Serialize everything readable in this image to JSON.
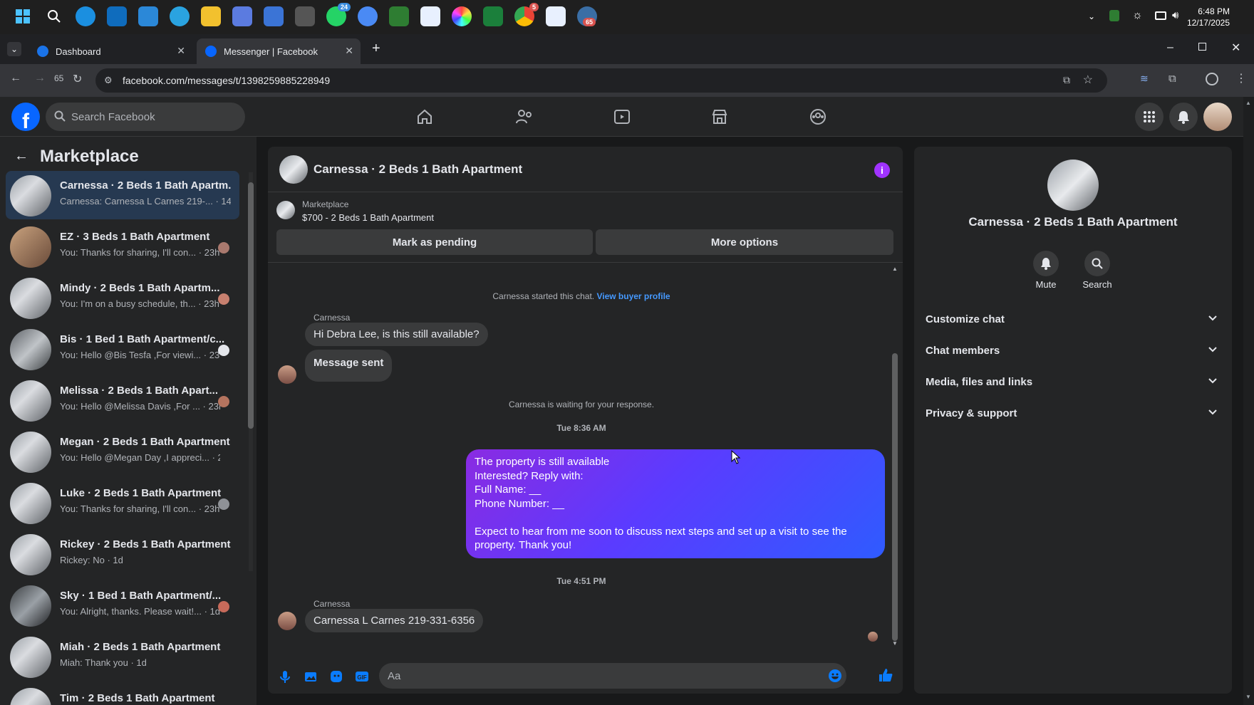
{
  "taskbar": {
    "time": "6:48 PM",
    "date": "12/17/2025",
    "badges": {
      "whatsapp": "24",
      "chrome": "5",
      "app": "65"
    }
  },
  "browser": {
    "tabs": [
      {
        "label": "Dashboard"
      },
      {
        "label": "Messenger | Facebook"
      }
    ],
    "url": "facebook.com/messages/t/1398259885228949",
    "ext_badge": "65"
  },
  "fb": {
    "search_placeholder": "Search Facebook"
  },
  "marketplace": {
    "title": "Marketplace",
    "conversations": [
      {
        "name": "Carnessa · 2 Beds 1 Bath Apartm...",
        "preview": "Carnessa: Carnessa L Carnes 219-... · 14h",
        "active": true
      },
      {
        "name": "EZ · 3 Beds 1 Bath Apartment",
        "preview": "You: Thanks for sharing, I'll con... · 23h"
      },
      {
        "name": "Mindy · 2 Beds 1 Bath Apartm...",
        "preview": "You: I'm on a busy schedule, th... · 23h"
      },
      {
        "name": "Bis · 1 Bed 1 Bath Apartment/c...",
        "preview": "You: Hello @Bis Tesfa ,For viewi... · 23h"
      },
      {
        "name": "Melissa · 2 Beds 1 Bath Apart...",
        "preview": "You: Hello @Melissa Davis ,For ... · 23h"
      },
      {
        "name": "Megan · 2 Beds 1 Bath Apartment",
        "preview": "You: Hello @Megan Day ,I appreci... · 23h"
      },
      {
        "name": "Luke · 2 Beds 1 Bath Apartment",
        "preview": "You: Thanks for sharing, I'll con... · 23h"
      },
      {
        "name": "Rickey · 2 Beds 1 Bath Apartment",
        "preview": "Rickey: No · 1d"
      },
      {
        "name": "Sky · 1 Bed 1 Bath Apartment/...",
        "preview": "You: Alright, thanks. Please wait!... · 1d"
      },
      {
        "name": "Miah · 2 Beds 1 Bath Apartment",
        "preview": "Miah: Thank you · 1d"
      },
      {
        "name": "Tim · 2 Beds 1 Bath Apartment",
        "preview": ""
      }
    ]
  },
  "chat": {
    "title": "Carnessa · 2 Beds 1 Bath Apartment",
    "listing_source": "Marketplace",
    "listing_price": "$700 - 2 Beds 1 Bath Apartment",
    "mark_pending_label": "Mark as pending",
    "more_options_label": "More options",
    "started_text": "Carnessa started this chat.",
    "view_buyer_label": "View buyer profile",
    "sender_1": "Carnessa",
    "msg_1": "Hi Debra Lee, is this still available?",
    "msg_2": "Message sent",
    "waiting_text": "Carnessa is waiting for your response.",
    "ts_1": "Tue 8:36 AM",
    "out_lines": [
      "The property is still available",
      "Interested? Reply with:",
      "Full Name: __",
      "Phone Number: __",
      "",
      "Expect to hear from me soon to discuss next steps and set up a visit to see the property. Thank you!"
    ],
    "ts_2": "Tue 4:51 PM",
    "sender_2": "Carnessa",
    "msg_3": "Carnessa L Carnes 219-331-6356",
    "composer_placeholder": "Aa"
  },
  "details": {
    "name": "Carnessa · 2 Beds 1 Bath Apartment",
    "mute_label": "Mute",
    "search_label": "Search",
    "sections": [
      {
        "label": "Customize chat"
      },
      {
        "label": "Chat members"
      },
      {
        "label": "Media, files and links"
      },
      {
        "label": "Privacy & support"
      }
    ]
  },
  "colors": {
    "accent": "#0866ff",
    "bubble_gradient_start": "#8a2be2",
    "bubble_gradient_end": "#2f5bff",
    "info_icon": "#a033ff"
  }
}
